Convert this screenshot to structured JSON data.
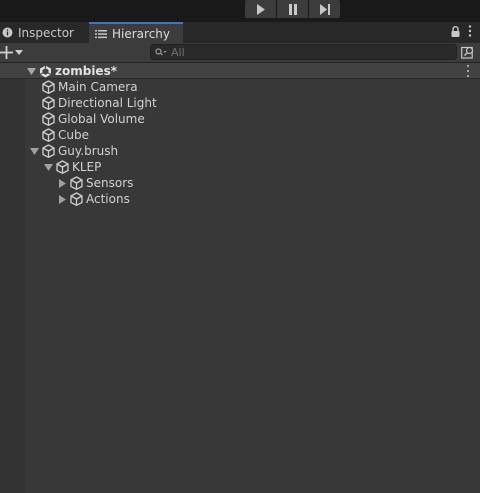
{
  "play_controls": {
    "play": "play-icon",
    "pause": "pause-icon",
    "step": "step-icon"
  },
  "tabs": [
    {
      "label": "Inspector",
      "icon": "info-icon",
      "active": false
    },
    {
      "label": "Hierarchy",
      "icon": "hierarchy-list-icon",
      "active": true
    }
  ],
  "tabbar_icons": [
    "lock-icon",
    "kebab-menu-icon"
  ],
  "toolbar": {
    "create_icon": "plus-icon",
    "search_placeholder": "All",
    "search_icon": "search-icon"
  },
  "hierarchy": {
    "scene": {
      "label": "zombies*",
      "icon": "unity-scene-icon",
      "expanded": true
    },
    "items": [
      {
        "label": "Main Camera",
        "depth": 1,
        "icon": "gameobject-cube-icon",
        "foldout": "none"
      },
      {
        "label": "Directional Light",
        "depth": 1,
        "icon": "gameobject-cube-icon",
        "foldout": "none"
      },
      {
        "label": "Global Volume",
        "depth": 1,
        "icon": "gameobject-cube-icon",
        "foldout": "none"
      },
      {
        "label": "Cube",
        "depth": 1,
        "icon": "gameobject-cube-icon",
        "foldout": "none"
      },
      {
        "label": "Guy.brush",
        "depth": 1,
        "icon": "gameobject-cube-icon",
        "foldout": "expanded"
      },
      {
        "label": "KLEP",
        "depth": 2,
        "icon": "gameobject-cube-icon",
        "foldout": "expanded"
      },
      {
        "label": "Sensors",
        "depth": 3,
        "icon": "gameobject-cube-icon",
        "foldout": "collapsed"
      },
      {
        "label": "Actions",
        "depth": 3,
        "icon": "gameobject-cube-icon",
        "foldout": "collapsed"
      }
    ]
  },
  "colors": {
    "accent": "#3a79bb",
    "panel_bg": "#383838",
    "toolbar_bg": "#3c3c3c"
  }
}
